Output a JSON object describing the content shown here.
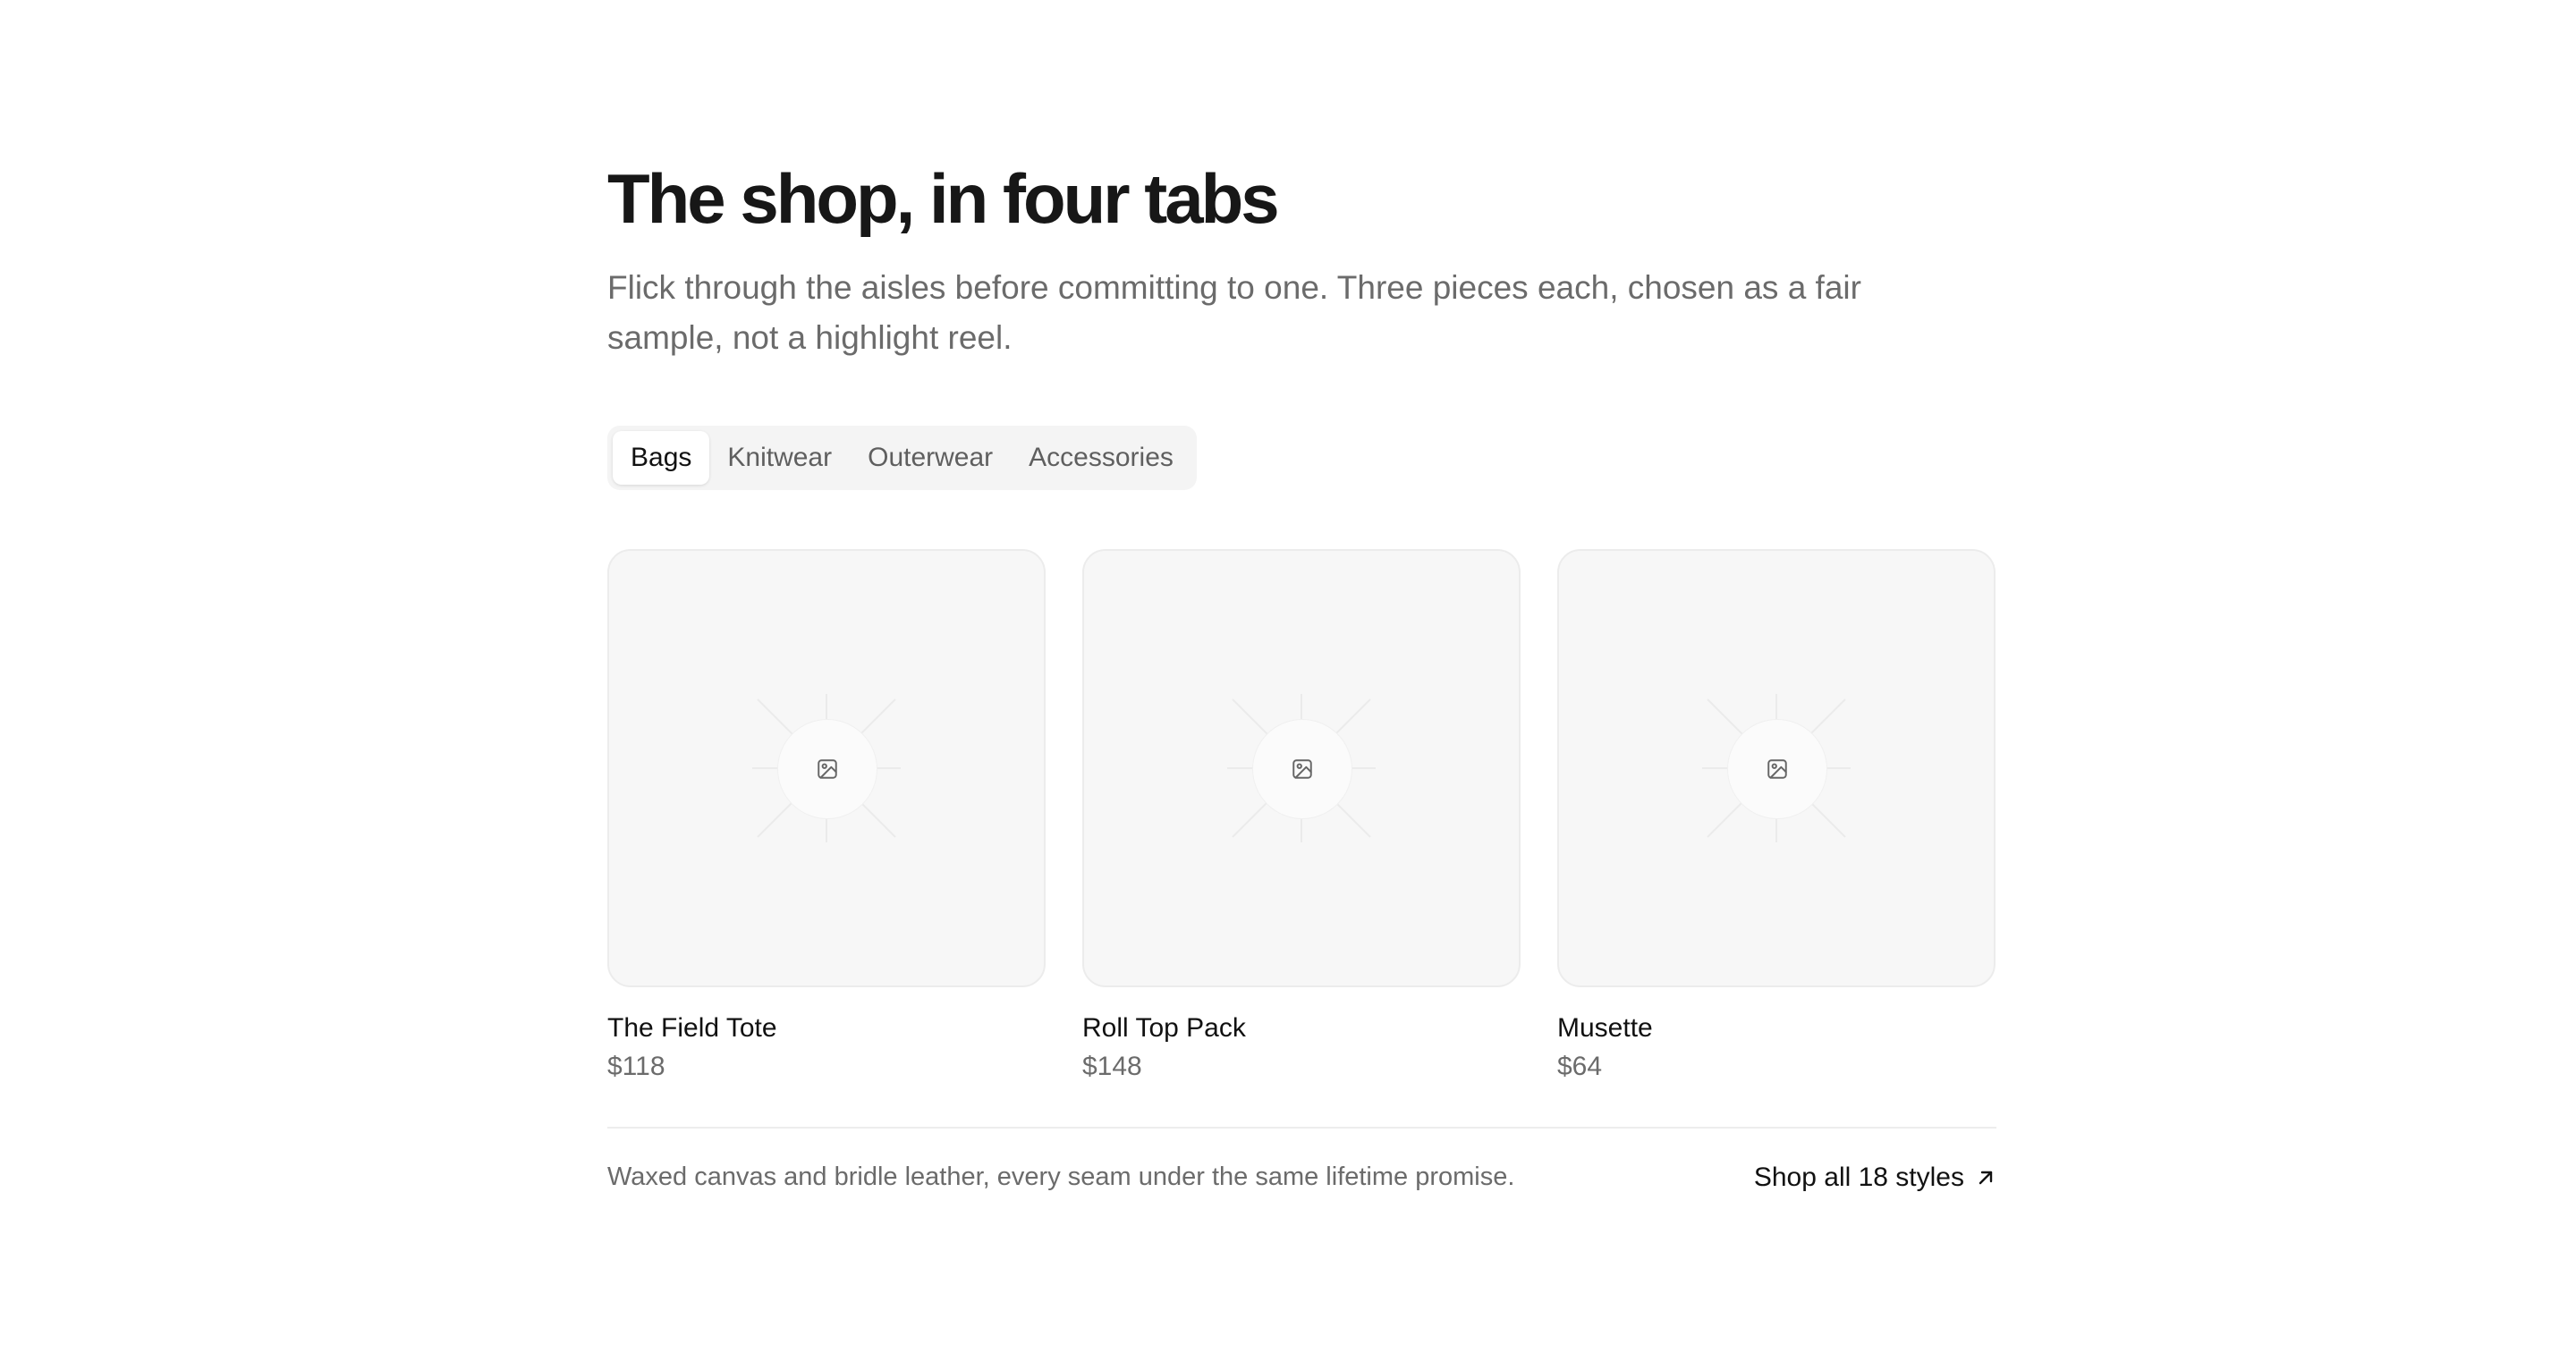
{
  "header": {
    "title": "The shop, in four tabs",
    "subtitle": "Flick through the aisles before committing to one. Three pieces each, chosen as a fair sample, not a highlight reel."
  },
  "tabs": [
    {
      "label": "Bags",
      "active": true
    },
    {
      "label": "Knitwear",
      "active": false
    },
    {
      "label": "Outerwear",
      "active": false
    },
    {
      "label": "Accessories",
      "active": false
    }
  ],
  "products": [
    {
      "name": "The Field Tote",
      "price": "$118",
      "image_icon": "image-placeholder-icon"
    },
    {
      "name": "Roll Top Pack",
      "price": "$148",
      "image_icon": "image-placeholder-icon"
    },
    {
      "name": "Musette",
      "price": "$64",
      "image_icon": "image-placeholder-icon"
    }
  ],
  "footer": {
    "note": "Waxed canvas and bridle leather, every seam under the same lifetime promise.",
    "link_label": "Shop all 18 styles",
    "link_icon": "arrow-up-right-icon"
  },
  "colors": {
    "text": "#111111",
    "muted": "#6b6b6b",
    "tab_bg": "#f4f4f4",
    "card_bg": "#f7f7f7",
    "border": "#ececec"
  }
}
